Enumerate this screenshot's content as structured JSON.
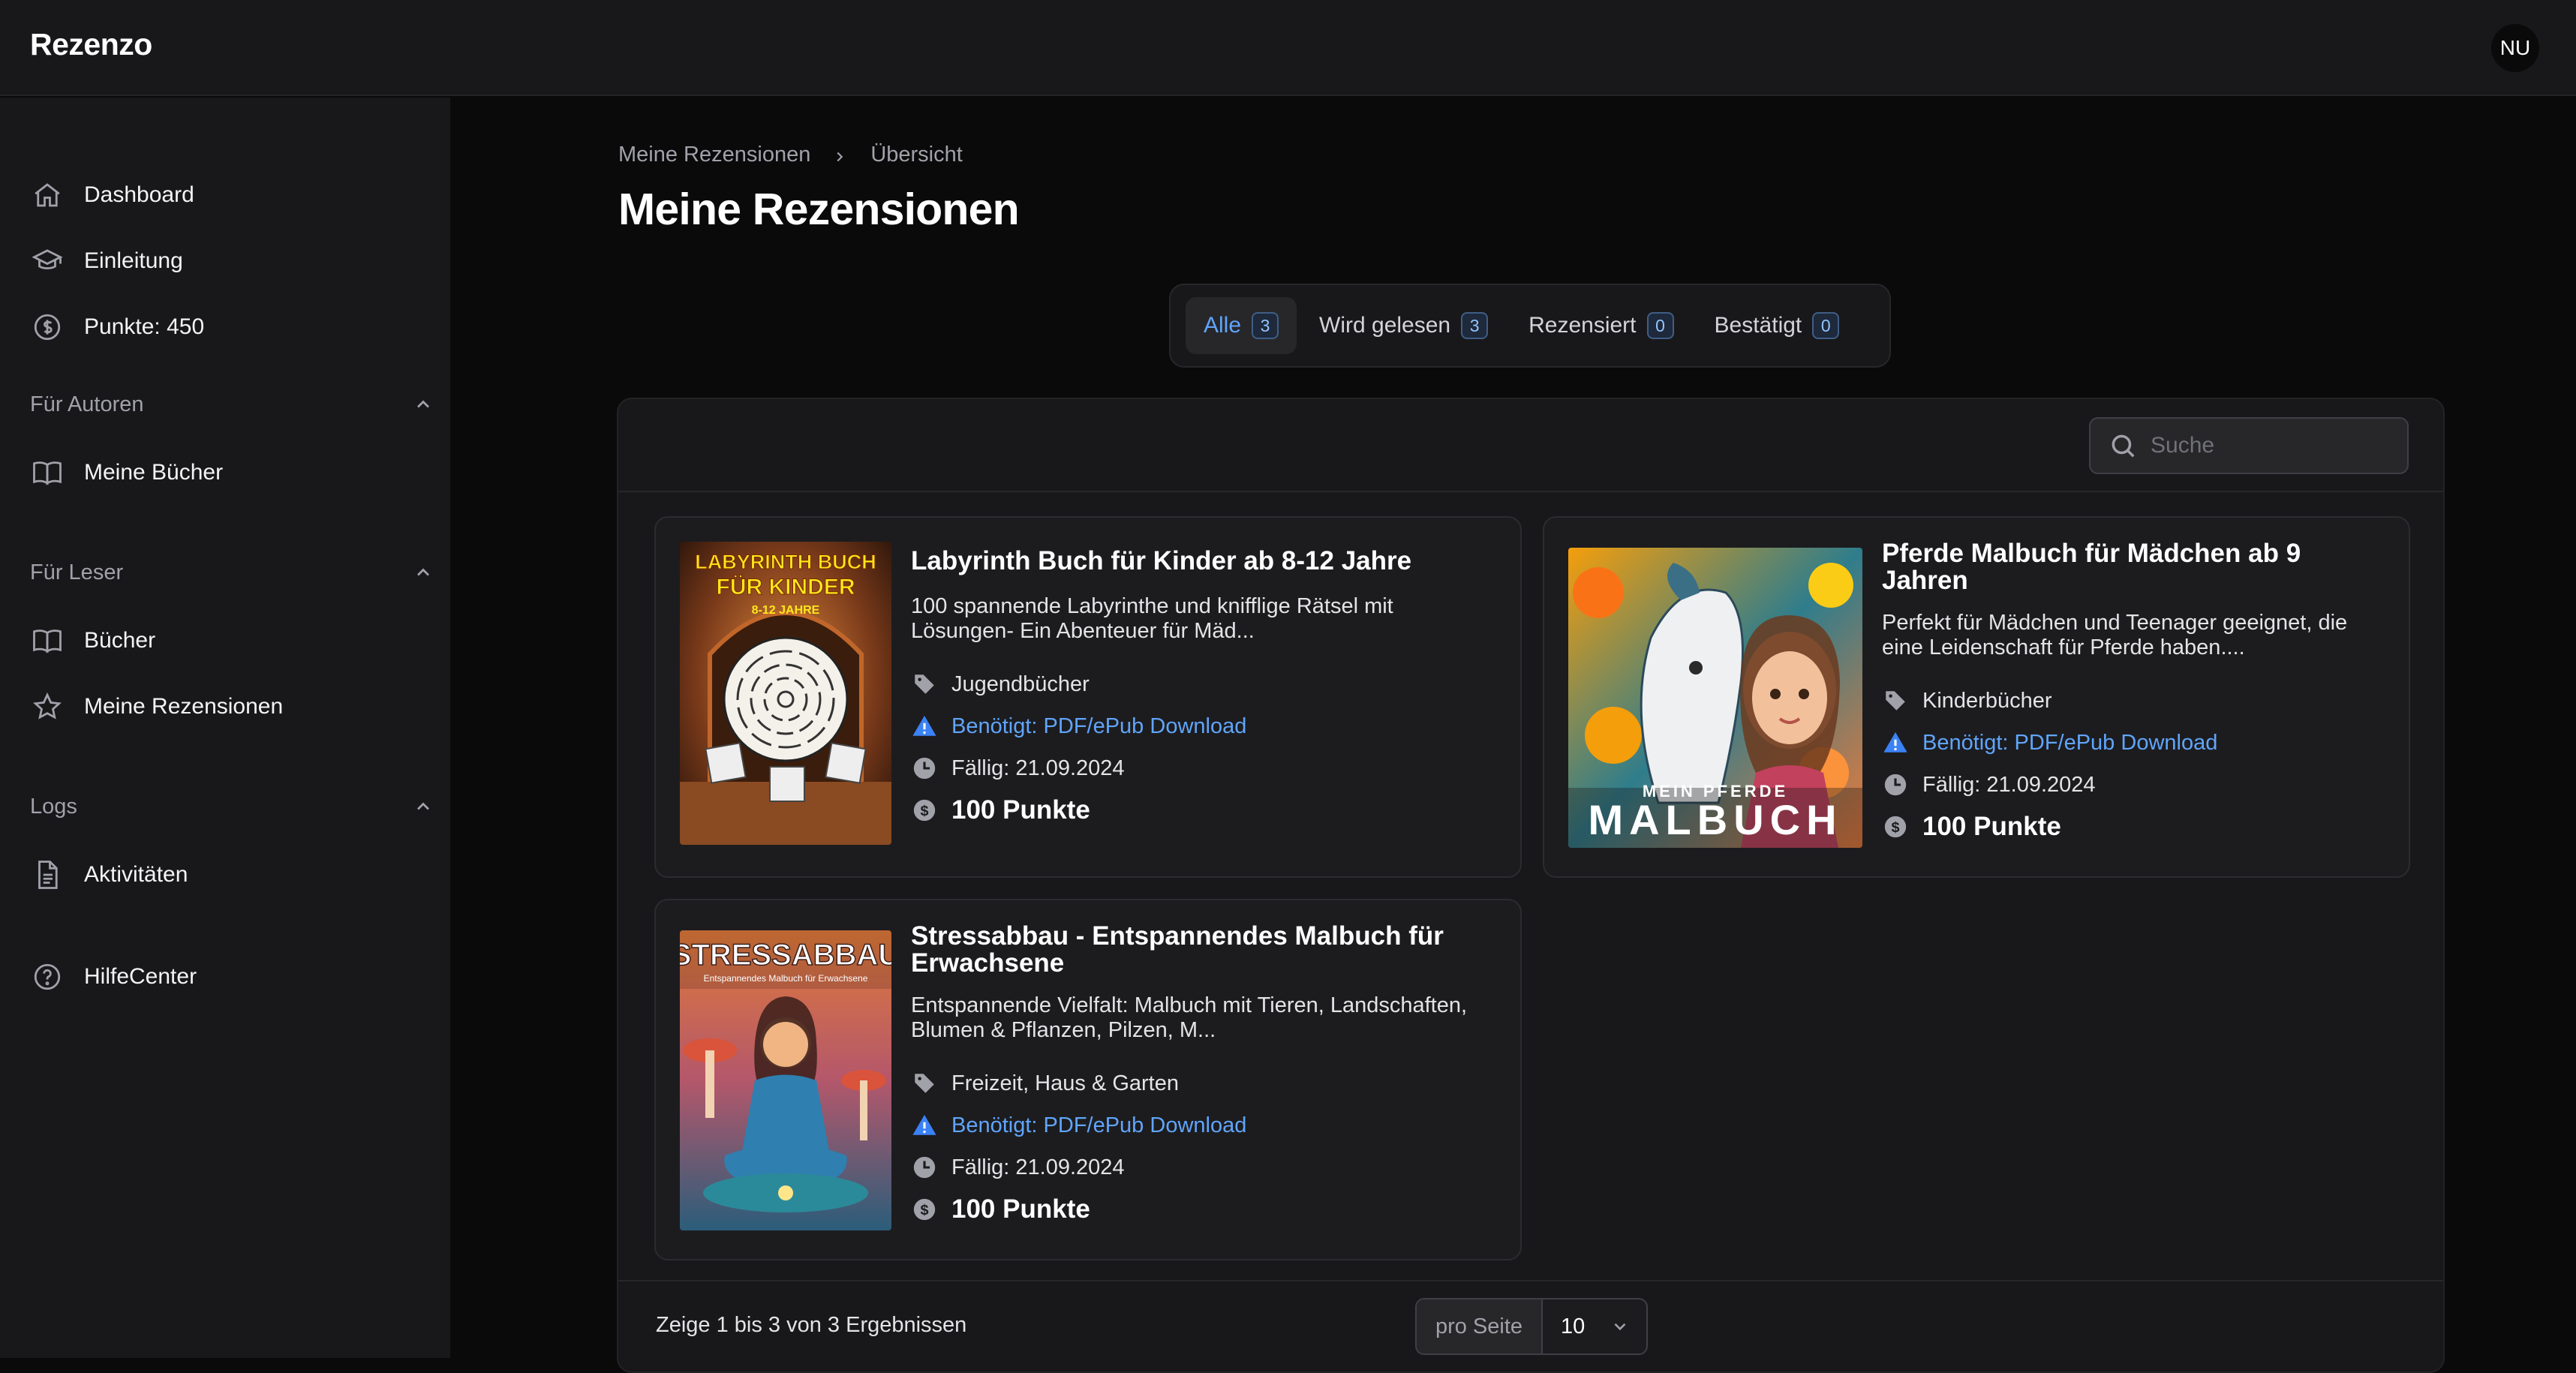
{
  "app": {
    "brand": "Rezenzo",
    "avatar_initials": "NU"
  },
  "sidebar": {
    "main_items": [
      {
        "label": "Dashboard",
        "icon": "home-icon"
      },
      {
        "label": "Einleitung",
        "icon": "graduation-cap-icon"
      },
      {
        "label": "Punkte: 450",
        "icon": "dollar-circle-icon"
      }
    ],
    "sections": [
      {
        "label": "Für Autoren",
        "items": [
          {
            "label": "Meine Bücher",
            "icon": "book-open-icon"
          }
        ]
      },
      {
        "label": "Für Leser",
        "items": [
          {
            "label": "Bücher",
            "icon": "book-open-icon"
          },
          {
            "label": "Meine Rezensionen",
            "icon": "star-icon"
          }
        ]
      },
      {
        "label": "Logs",
        "items": [
          {
            "label": "Aktivitäten",
            "icon": "document-icon"
          }
        ]
      }
    ],
    "help": {
      "label": "HilfeCenter",
      "icon": "question-circle-icon"
    }
  },
  "breadcrumb": {
    "parent": "Meine Rezensionen",
    "current": "Übersicht"
  },
  "page_title": "Meine Rezensionen",
  "tabs": [
    {
      "label": "Alle",
      "count": "3",
      "active": true
    },
    {
      "label": "Wird gelesen",
      "count": "3",
      "active": false
    },
    {
      "label": "Rezensiert",
      "count": "0",
      "active": false
    },
    {
      "label": "Bestätigt",
      "count": "0",
      "active": false
    }
  ],
  "search": {
    "placeholder": "Suche"
  },
  "books": [
    {
      "title": "Labyrinth Buch für Kinder ab 8-12 Jahre",
      "description": "100 spannende Labyrinthe und knifflige Rätsel mit Lösungen- Ein Abenteuer für Mäd...",
      "category": "Jugendbücher",
      "requirement": "Benötigt: PDF/ePub Download",
      "due": "Fällig: 21.09.2024",
      "points": "100 Punkte",
      "cover_text": [
        "LABYRINTH BUCH",
        "FÜR KINDER",
        "8-12 JAHRE"
      ]
    },
    {
      "title": "Pferde Malbuch für Mädchen ab 9 Jahren",
      "description": "Perfekt für Mädchen und Teenager geeignet, die eine Leidenschaft für Pferde haben....",
      "category": "Kinderbücher",
      "requirement": "Benötigt: PDF/ePub Download",
      "due": "Fällig: 21.09.2024",
      "points": "100 Punkte",
      "cover_text": [
        "MEIN PFERDE",
        "MALBUCH"
      ]
    },
    {
      "title": "Stressabbau - Entspannendes Malbuch für Erwachsene",
      "description": "Entspannende Vielfalt: Malbuch mit Tieren, Landschaften, Blumen & Pflanzen, Pilzen, M...",
      "category": "Freizeit, Haus & Garten",
      "requirement": "Benötigt: PDF/ePub Download",
      "due": "Fällig: 21.09.2024",
      "points": "100 Punkte",
      "cover_text": [
        "STRESSABBAU",
        "Entspannendes Malbuch für Erwachsene"
      ]
    }
  ],
  "footer": {
    "results": "Zeige 1 bis 3 von 3 Ergebnissen",
    "per_page_label": "pro Seite",
    "per_page_value": "10"
  },
  "colors": {
    "accent": "#60a5fa",
    "background": "#0a0a0b",
    "surface": "#18181b"
  }
}
